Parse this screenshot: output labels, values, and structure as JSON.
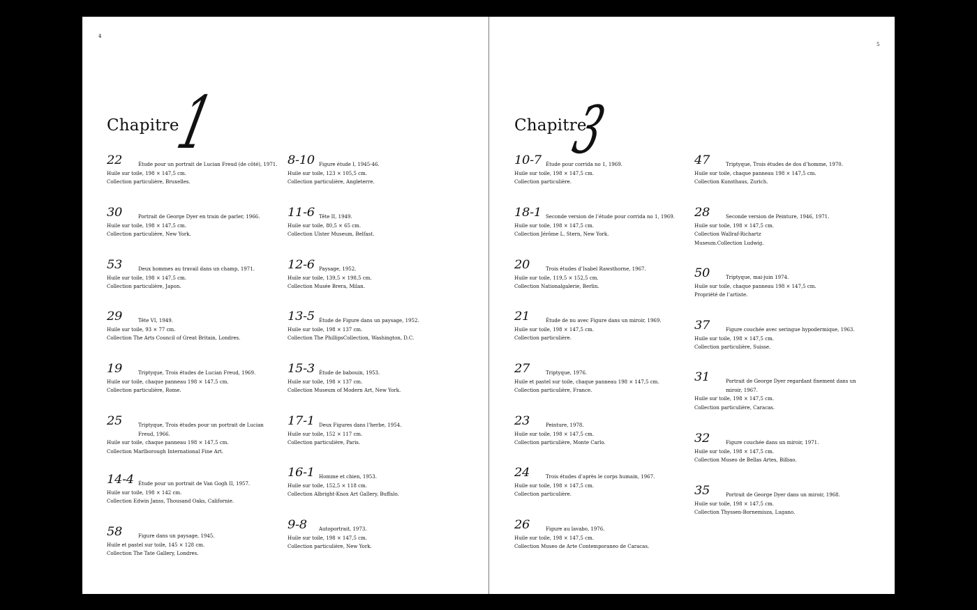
{
  "left_page": {
    "page_number": "4",
    "chapter": {
      "word": "Chapitre",
      "numeral": "1"
    },
    "columns": [
      [
        {
          "num": "22",
          "title": "Étude pour un portrait de Lucian Freud (de côté), 1971.",
          "medium": "Huile sur toile, 198 × 147,5 cm.",
          "collection": "Collection particulière, Bruxelles."
        },
        {
          "num": "30",
          "title": "Portrait de George Dyer en train de parler, 1966.",
          "medium": "Huile sur toile, 198 × 147,5 cm.",
          "collection": "Collection particulière, New York."
        },
        {
          "num": "53",
          "title": "Deux hommes au travail dans un champ, 1971.",
          "medium": "Huile sur toile, 198 × 147,5 cm.",
          "collection": "Collection particulière, Japon."
        },
        {
          "num": "29",
          "title": "Tête VI, 1949.",
          "medium": "Huile sur toile, 93 × 77 cm.",
          "collection": "Collection The Arts Council of Great Britain, Londres."
        },
        {
          "num": "19",
          "title": "Triptyque, Trois études de Lucian Freud, 1969.",
          "medium": "Huile sur toile, chaque panneau 198 × 147,5 cm.",
          "collection": "Collection particulière, Rome."
        },
        {
          "num": "25",
          "title": "Triptyque, Trois études pour un portrait de Lucian Freud, 1966.",
          "medium": "Huile sur toile, chaque panneau 198 × 147,5 cm.",
          "collection": "Collection Marlborough International Fine Art."
        },
        {
          "num": "14-4",
          "title": "Étude pour un portrait de Van Gogh II, 1957.",
          "medium": "Huile sur toile, 198 × 142 cm.",
          "collection": "Collection Edwin Janss, Thousand Oaks, Californie."
        },
        {
          "num": "58",
          "title": "Figure dans un paysage, 1945.",
          "medium": "Huile et pastel sur toile, 145 × 128 cm.",
          "collection": "Collection The Tate Gallery, Londres."
        }
      ],
      [
        {
          "num": "8-10",
          "title": "Figure étude I, 1945-46.",
          "medium": "Huile sur toile, 123 × 105,5 cm.",
          "collection": "Collection particulière, Angleterre."
        },
        {
          "num": "11-6",
          "title": "Tête II, 1949.",
          "medium": "Huile sur toile, 80,5 × 65 cm.",
          "collection": "Collection Ulster Museum, Belfast."
        },
        {
          "num": "12-6",
          "title": "Paysage, 1952.",
          "medium": "Huile sur toile, 139,5 × 198,5 cm.",
          "collection": "Collection Musée Brera, Milan."
        },
        {
          "num": "13-5",
          "title": "Étude de Figure dans un paysage, 1952.",
          "medium": "Huile sur toile, 198 × 137 cm.",
          "collection": "Collection The PhillipsCollection, Washington, D.C."
        },
        {
          "num": "15-3",
          "title": "Étude de babouin, 1953.",
          "medium": "Huile sur toile, 198 × 137 cm.",
          "collection": "Collection Museum of Modern Art, New York."
        },
        {
          "num": "17-1",
          "title": "Deux Figures dans l’herbe, 1954.",
          "medium": "Huile sur toile, 152 × 117 cm.",
          "collection": "Collection particulière, Paris."
        },
        {
          "num": "16-1",
          "title": "Homme et chien, 1953.",
          "medium": "Huile sur toile, 152,5 × 118 cm.",
          "collection": "Collection Albright-Knox Art Gallery, Buffalo."
        },
        {
          "num": "9-8",
          "title": "Autoportrait, 1973.",
          "medium": "Huile sur toile, 198 × 147,5 cm.",
          "collection": "Collection particulière, New York."
        }
      ]
    ]
  },
  "right_page": {
    "page_number": "5",
    "chapter": {
      "word": "Chapitre",
      "numeral": "3"
    },
    "columns": [
      [
        {
          "num": "10-7",
          "title": "Étude pour corrida no 1, 1969.",
          "medium": "Huile sur toile, 198 × 147,5 cm.",
          "collection": "Collection particulière."
        },
        {
          "num": "18-1",
          "title": "Seconde version de l’étude pour corrida no 1, 1969.",
          "medium": "Huile sur toile, 198 × 147,5 cm.",
          "collection": "Collection Jérôme L. Stern, New York."
        },
        {
          "num": "20",
          "title": "Trois études d’Isabel Rawsthorne, 1967.",
          "medium": "Huile sur toile, 119,5 × 152,5 cm.",
          "collection": "Collection Nationalgalerie, Berlin."
        },
        {
          "num": "21",
          "title": "Étude de nu avec Figure dans un miroir, 1969.",
          "medium": "Huile sur toile, 198 × 147,5 cm.",
          "collection": "Collection particulière."
        },
        {
          "num": "27",
          "title": "Triptyque, 1976.",
          "medium": "Huile et pastel sur toile, chaque panneau 198 × 147,5 cm.",
          "collection": "Collection particulière, France."
        },
        {
          "num": "23",
          "title": "Peinture, 1978.",
          "medium": "Huile sur toile, 198 × 147,5 cm.",
          "collection": "Collection particulière, Monte Carlo."
        },
        {
          "num": "24",
          "title": "Trois études d’après le corps humain, 1967.",
          "medium": "Huile sur toile, 198 × 147,5 cm.",
          "collection": "Collection particulière."
        },
        {
          "num": "26",
          "title": "Figure au lavabo, 1976.",
          "medium": "Huile sur toile, 198 × 147,5 cm.",
          "collection": "Collection Museo de Arte Contemporaneo de Caracas."
        }
      ],
      [
        {
          "num": "47",
          "title": "Triptyque, Trois études de dos d’homme, 1970.",
          "medium": "Huile sur toile, chaque panneau 198 × 147,5 cm.",
          "collection": "Collection Kunsthaus, Zurich."
        },
        {
          "num": "28",
          "title": "Seconde version de Peinture, 1946, 1971.",
          "medium": "Huile sur toile, 198 × 147,5 cm.",
          "collection": "Collection Wallraf-Richartz",
          "collection2": "Museum.Collection Ludwig."
        },
        {
          "num": "50",
          "title": "Triptyque, mai-juin 1974.",
          "medium": "Huile sur toile, chaque panneau 198 × 147,5 cm.",
          "collection": "Propriété de l’artiste."
        },
        {
          "num": "37",
          "title": "Figure couchée avec seringue hypodermique, 1963.",
          "medium": "Huile sur toile, 198 × 147,5 cm.",
          "collection": "Collection particulière, Suisse."
        },
        {
          "num": "31",
          "title": "Portrait de George Dyer regardant fixement dans un miroir, 1967.",
          "medium": "Huile sur toile, 198 × 147,5 cm.",
          "collection": "Collection particulière, Caracas."
        },
        {
          "num": "32",
          "title": "Figure couchée dans un miroir, 1971.",
          "medium": "Huile sur toile, 198 × 147,5 cm.",
          "collection": "Collection Museo de Bellas Artes, Bilbao."
        },
        {
          "num": "35",
          "title": "Portrait de George Dyer dans un miroir, 1968.",
          "medium": "Huile sur toile, 198 × 147,5 cm.",
          "collection": "Collection Thyssen-Bornemisza, Lugano."
        }
      ]
    ]
  }
}
